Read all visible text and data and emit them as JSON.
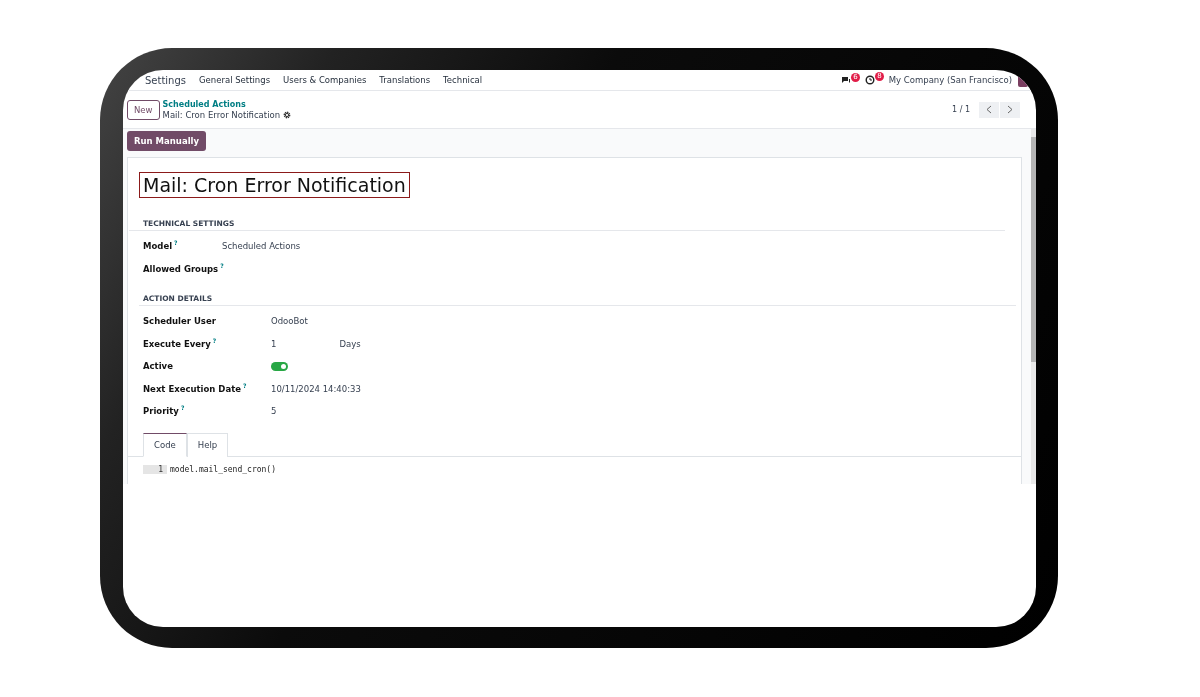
{
  "navbar": {
    "app": "Settings",
    "menu": [
      "General Settings",
      "Users & Companies",
      "Translations",
      "Technical"
    ],
    "systray": [
      {
        "kind": "chat",
        "badge": "6"
      },
      {
        "kind": "activity",
        "badge": "8"
      }
    ],
    "company": "My Company (San Francisco)"
  },
  "control_panel": {
    "new_button": "New",
    "breadcrumb": "Scheduled Actions",
    "record": "Mail: Cron Error Notification",
    "pager": "1 / 1"
  },
  "action_button": "Run Manually",
  "title": "Mail: Cron Error Notification",
  "sections": [
    {
      "heading": "TECHNICAL SETTINGS",
      "fields": [
        {
          "kind": "text",
          "label": "Model",
          "help": "?",
          "value": "Scheduled Actions"
        },
        {
          "kind": "text",
          "label": "Allowed Groups",
          "help": "?"
        }
      ]
    },
    {
      "heading": "ACTION DETAILS",
      "fields": [
        {
          "kind": "text",
          "label": "Scheduler User",
          "value": "OdooBot"
        },
        {
          "kind": "interval",
          "label": "Execute Every",
          "help": "?",
          "value": "1",
          "unit": "Days"
        },
        {
          "kind": "toggle",
          "label": "Active",
          "on": true
        },
        {
          "kind": "text",
          "label": "Next Execution Date",
          "help": "?",
          "value": "10/11/2024 14:40:33"
        },
        {
          "kind": "text",
          "label": "Priority",
          "help": "?",
          "value": "5"
        }
      ]
    }
  ],
  "tabs": [
    {
      "label": "Code",
      "selected": true
    },
    {
      "label": "Help",
      "selected": false
    }
  ],
  "code": [
    {
      "line": "1",
      "text": "model.mail_send_cron()"
    }
  ]
}
